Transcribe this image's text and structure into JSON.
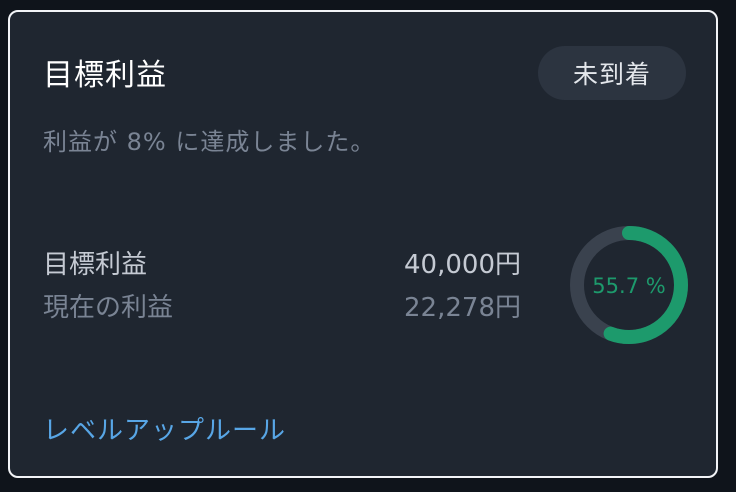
{
  "card": {
    "title": "目標利益",
    "status_badge": "未到着",
    "subtitle": "利益が 8% に達成しました。",
    "rows": [
      {
        "label": "目標利益",
        "value": "40,000円"
      },
      {
        "label": "現在の利益",
        "value": "22,278円"
      }
    ],
    "progress": {
      "percent": 55.7,
      "label": "55.7 %"
    },
    "link_label": "レベルアップルール"
  },
  "colors": {
    "card_bg": "#1f2630",
    "progress": "#1d9a6c",
    "track": "#3a424e",
    "link": "#58a6e6"
  }
}
